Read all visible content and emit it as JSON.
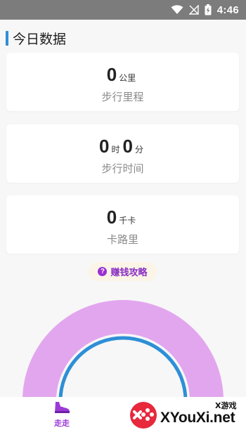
{
  "status_bar": {
    "time": "4:46",
    "icons": [
      "wifi-icon",
      "signal-off-icon",
      "battery-charging-icon"
    ]
  },
  "section": {
    "title": "今日数据"
  },
  "cards": {
    "distance": {
      "value": "0",
      "unit": "公里",
      "label": "步行里程"
    },
    "time": {
      "hours": "0",
      "hours_unit": "时",
      "minutes": "0",
      "minutes_unit": "分",
      "label": "步行时间"
    },
    "calories": {
      "value": "0",
      "unit": "千卡",
      "label": "卡路里"
    }
  },
  "guide": {
    "icon": "question-icon",
    "label": "赚钱攻略"
  },
  "gauge": {
    "progress": 0,
    "outer_color": "#e2a6ee",
    "inner_color": "#2e8fd6"
  },
  "bottom_nav": {
    "items": [
      {
        "icon": "shoe-icon",
        "label": "走走",
        "active": true,
        "color": "#9b3ad6"
      }
    ]
  },
  "watermark": {
    "icon": "gamepad-logo-icon",
    "tag": "X游戏",
    "text": "XYouXi.net"
  },
  "colors": {
    "accent": "#2e8fd6",
    "purple": "#9b3ad6",
    "background": "#f7f7f7"
  }
}
